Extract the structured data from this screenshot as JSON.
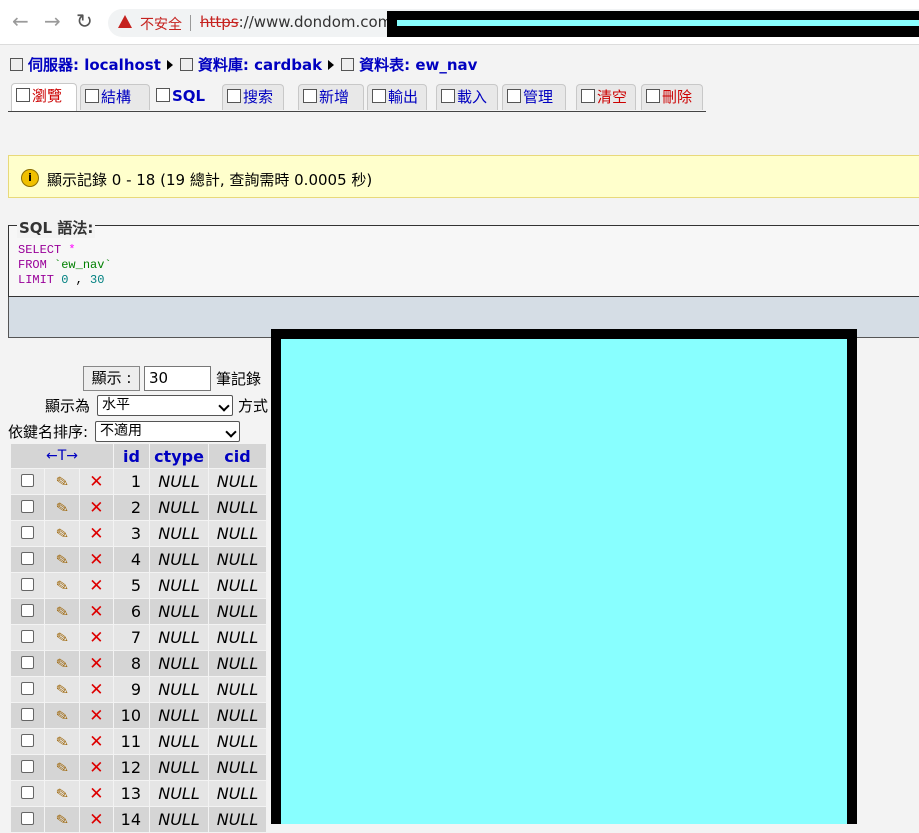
{
  "browser": {
    "warning_text": "不安全",
    "url_scheme": "https",
    "url_rest": "://www.dondom.com.tw"
  },
  "breadcrumb": {
    "server": "伺服器: localhost",
    "database": "資料庫: cardbak",
    "table": "資料表: ew_nav"
  },
  "tabs": [
    "瀏覽",
    "結構",
    "SQL",
    "搜索",
    "新增",
    "輸出",
    "載入",
    "管理",
    "清空",
    "刪除"
  ],
  "notice": {
    "text": "顯示記錄 0 - 18 (19 總計, 查詢需時 0.0005 秒)"
  },
  "sql": {
    "legend": "SQL 語法:",
    "select": "SELECT",
    "star": "*",
    "from": "FROM",
    "table": "`ew_nav`",
    "limit": "LIMIT",
    "offset": "0",
    "comma": ",",
    "count": "30"
  },
  "controls": {
    "show_button": "顯示 :",
    "rows_value": "30",
    "rows_suffix": "筆記錄",
    "display_as_label": "顯示為",
    "display_mode": "水平",
    "display_suffix": "方式",
    "sort_label": "依鍵名排序:",
    "sort_value": "不適用"
  },
  "table": {
    "nav_arrows": "←T→",
    "columns": [
      "id",
      "ctype",
      "cid"
    ],
    "null_text": "NULL",
    "rows": [
      "1",
      "2",
      "3",
      "4",
      "5",
      "6",
      "7",
      "8",
      "9",
      "10",
      "11",
      "12",
      "13",
      "14"
    ]
  }
}
